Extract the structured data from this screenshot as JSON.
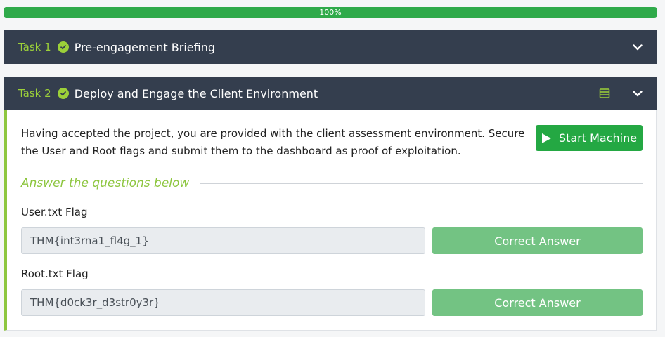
{
  "progress": {
    "percent": 100,
    "label": "100%"
  },
  "tasks": [
    {
      "number": "Task 1",
      "title": "Pre-engagement Briefing",
      "completed": true,
      "expanded": false
    },
    {
      "number": "Task 2",
      "title": "Deploy and Engage the Client Environment",
      "completed": true,
      "expanded": true,
      "description": "Having accepted the project, you are provided with the client assessment environment.  Secure the User and Root flags and submit them to the dashboard as proof of exploitation.",
      "start_button": "Start Machine",
      "answer_heading": "Answer the questions below",
      "questions": [
        {
          "label": "User.txt Flag",
          "value": "THM{int3rna1_fl4g_1}",
          "status": "Correct Answer"
        },
        {
          "label": "Root.txt Flag",
          "value": "THM{d0ck3r_d3str0y3r}",
          "status": "Correct Answer"
        }
      ]
    }
  ],
  "colors": {
    "accent": "#8dc63f",
    "header_bg": "#343e4e",
    "start_green": "#24a843",
    "correct_green": "#73c383"
  }
}
